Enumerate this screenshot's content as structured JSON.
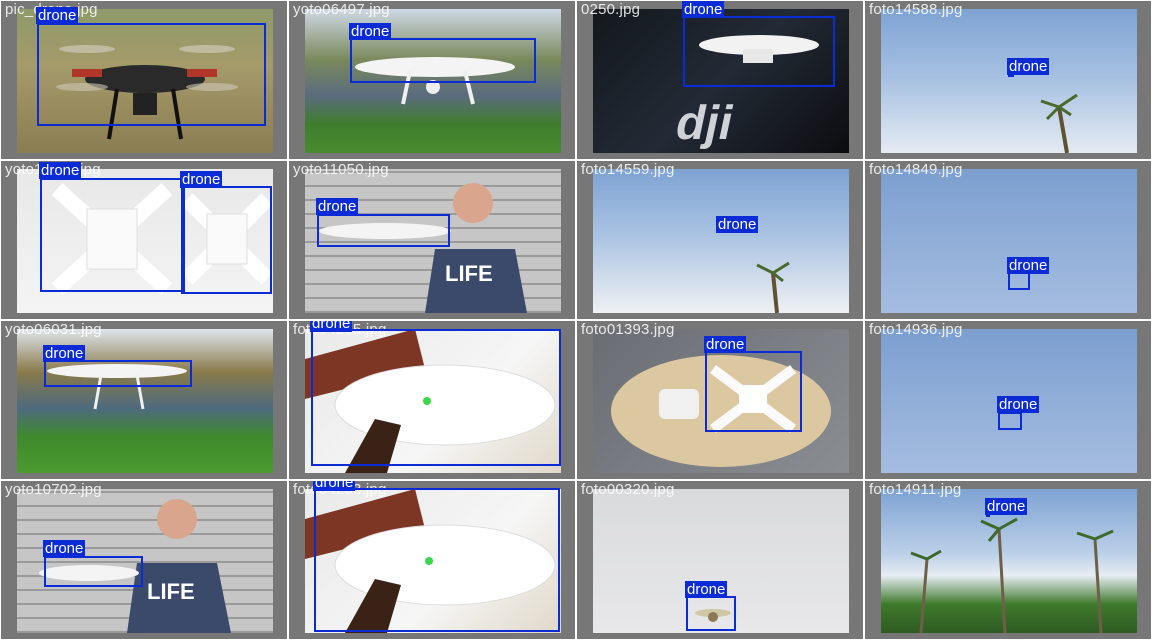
{
  "colors": {
    "box": "#0b2bd6",
    "tile_border": "#777777",
    "label_text": "#ffffff"
  },
  "tiles": [
    {
      "file": "pic_drone.jpg",
      "label": "drone"
    },
    {
      "file": "yoto06497.jpg",
      "label": "drone"
    },
    {
      "file": "0250.jpg",
      "label": "drone"
    },
    {
      "file": "foto14588.jpg",
      "label": "drone"
    },
    {
      "file": "yoto11009.jpg",
      "label": "drone",
      "label2": "drone"
    },
    {
      "file": "yoto11050.jpg",
      "label": "drone"
    },
    {
      "file": "foto14559.jpg",
      "label": "drone"
    },
    {
      "file": "foto14849.jpg",
      "label": "drone"
    },
    {
      "file": "yoto06031.jpg",
      "label": "drone"
    },
    {
      "file": "foto04235.jpg",
      "label": "drone"
    },
    {
      "file": "foto01393.jpg",
      "label": "drone"
    },
    {
      "file": "foto14936.jpg",
      "label": "drone"
    },
    {
      "file": "yoto10702.jpg",
      "label": "drone"
    },
    {
      "file": "foto04293.jpg",
      "label": "drone"
    },
    {
      "file": "foto00320.jpg",
      "label": "drone"
    },
    {
      "file": "foto14911.jpg",
      "label": "drone"
    }
  ]
}
